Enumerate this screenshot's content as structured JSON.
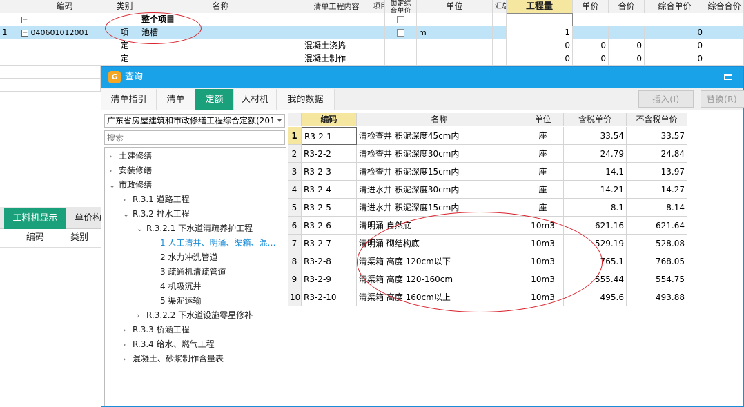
{
  "background_table": {
    "headers": [
      "编码",
      "类别",
      "名称",
      "清单工程内容",
      "项目",
      "锁定综合单价",
      "单位",
      "汇总",
      "工程量",
      "单价",
      "合价",
      "综合单价",
      "综合合价"
    ],
    "group_row": {
      "name": "整个项目"
    },
    "item_row": {
      "index": "1",
      "code": "040601012001",
      "type": "项",
      "name": "池槽",
      "unit": "m",
      "quantity": "1",
      "comp_price": "0"
    },
    "sub_rows": [
      {
        "type": "定",
        "content": "混凝土浇捣",
        "quantity": "0",
        "price": "0",
        "total": "0",
        "comp_price": "0"
      },
      {
        "type": "定",
        "content": "混凝土制作",
        "quantity": "0",
        "price": "0",
        "total": "0",
        "comp_price": "0"
      }
    ]
  },
  "left_panel": {
    "tab_active": "工料机显示",
    "tab_inactive": "单价构",
    "col_code": "编码",
    "col_type": "类别"
  },
  "dialog": {
    "title": "查询",
    "tabs": [
      "清单指引",
      "清单",
      "定额",
      "人材机",
      "我的数据"
    ],
    "active_tab": "定额",
    "insert_label": "插入(I)",
    "replace_label": "替换(R)",
    "library": "广东省房屋建筑和市政修缮工程综合定额(201",
    "search_placeholder": "搜索",
    "tree": [
      {
        "label": "土建修缮"
      },
      {
        "label": "安装修缮"
      },
      {
        "label": "市政修缮"
      },
      {
        "label": "R.3.1 道路工程"
      },
      {
        "label": "R.3.2 排水工程"
      },
      {
        "label": "R.3.2.1 下水道清疏养护工程"
      },
      {
        "label": "1 人工清井、明涌、渠箱、混…"
      },
      {
        "label": "2 水力冲洗管道"
      },
      {
        "label": "3 疏通机清疏管道"
      },
      {
        "label": "4 机吸沉井"
      },
      {
        "label": "5 渠泥运输"
      },
      {
        "label": "R.3.2.2 下水道设施零星修补"
      },
      {
        "label": "R.3.3 桥涵工程"
      },
      {
        "label": "R.3.4 给水、燃气工程"
      },
      {
        "label": "混凝土、砂浆制作含量表"
      }
    ],
    "grid_headers": [
      "编码",
      "名称",
      "单位",
      "含税单价",
      "不含税单价"
    ],
    "rows": [
      {
        "idx": "1",
        "code": "R3-2-1",
        "name": "清检查井 积泥深度45cm内",
        "unit": "座",
        "tax_price": "33.54",
        "notax_price": "33.57"
      },
      {
        "idx": "2",
        "code": "R3-2-2",
        "name": "清检查井 积泥深度30cm内",
        "unit": "座",
        "tax_price": "24.79",
        "notax_price": "24.84"
      },
      {
        "idx": "3",
        "code": "R3-2-3",
        "name": "清检查井 积泥深度15cm内",
        "unit": "座",
        "tax_price": "14.1",
        "notax_price": "13.97"
      },
      {
        "idx": "4",
        "code": "R3-2-4",
        "name": "清进水井 积泥深度30cm内",
        "unit": "座",
        "tax_price": "14.21",
        "notax_price": "14.27"
      },
      {
        "idx": "5",
        "code": "R3-2-5",
        "name": "清进水井 积泥深度15cm内",
        "unit": "座",
        "tax_price": "8.1",
        "notax_price": "8.14"
      },
      {
        "idx": "6",
        "code": "R3-2-6",
        "name": "清明涌 自然底",
        "unit": "10m3",
        "tax_price": "621.16",
        "notax_price": "621.64"
      },
      {
        "idx": "7",
        "code": "R3-2-7",
        "name": "清明涌 砌结构底",
        "unit": "10m3",
        "tax_price": "529.19",
        "notax_price": "528.08"
      },
      {
        "idx": "8",
        "code": "R3-2-8",
        "name": "清渠箱 高度 120cm以下",
        "unit": "10m3",
        "tax_price": "765.1",
        "notax_price": "768.05"
      },
      {
        "idx": "9",
        "code": "R3-2-9",
        "name": "清渠箱 高度 120-160cm",
        "unit": "10m3",
        "tax_price": "555.44",
        "notax_price": "554.75"
      },
      {
        "idx": "10",
        "code": "R3-2-10",
        "name": "清渠箱 高度 160cm以上",
        "unit": "10m3",
        "tax_price": "495.6",
        "notax_price": "493.88"
      }
    ]
  }
}
